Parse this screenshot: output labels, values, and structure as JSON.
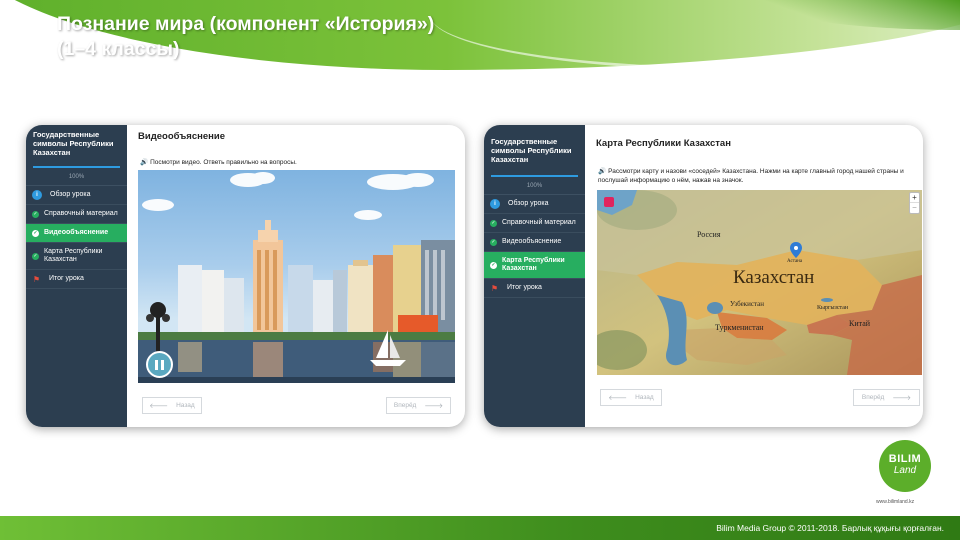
{
  "header": {
    "title_line1": "Познание мира (компонент «История»)",
    "title_line2": "(1–4 классы)"
  },
  "left_card": {
    "sidebar": {
      "title": "Государственные символы Республики Казахстан",
      "progress_percent": "100%",
      "progress_value": 1.0,
      "items": [
        {
          "label": "Обзор урока",
          "icon": "info-icon"
        },
        {
          "label": "Справочный материал",
          "icon": "check-icon"
        },
        {
          "label": "Видеообъяснение",
          "icon": "check-icon",
          "active": true
        },
        {
          "label": "Карта Республики Казахстан",
          "icon": "check-icon"
        },
        {
          "label": "Итог урока",
          "icon": "flag-icon"
        }
      ]
    },
    "content": {
      "title": "Видеообъяснение",
      "instruction": "Посмотри видео. Ответь правильно на вопросы.",
      "back_label": "Назад",
      "next_label": "Вперёд"
    }
  },
  "right_card": {
    "sidebar": {
      "title": "Государственные символы Республики Казахстан",
      "progress_percent": "100%",
      "progress_value": 1.0,
      "items": [
        {
          "label": "Обзор урока",
          "icon": "info-icon"
        },
        {
          "label": "Справочный материал",
          "icon": "check-icon"
        },
        {
          "label": "Видеообъяснение",
          "icon": "check-icon"
        },
        {
          "label": "Карта Республики Казахстан",
          "icon": "check-icon",
          "active": true
        },
        {
          "label": "Итог урока",
          "icon": "flag-icon"
        }
      ]
    },
    "content": {
      "title": "Карта Республики Казахстан",
      "instruction": "Рассмотри карту и назови «соседей» Казахстана. Нажми на карте главный город нашей страны и послушай информацию о нём, нажав на значок.",
      "map_labels": {
        "russia": "Россия",
        "kazakhstan": "Казахстан",
        "astana": "Астана",
        "uzbekistan": "Узбекистан",
        "kyrgyzstan": "Кыргызстан",
        "turkmenistan": "Туркменистан",
        "china": "Китай"
      },
      "zoom_in": "+",
      "zoom_out": "−",
      "back_label": "Назад",
      "next_label": "Вперёд"
    }
  },
  "logo": {
    "line1": "BILIM",
    "line2": "Land",
    "url": "www.bilimland.kz"
  },
  "footer": {
    "copyright": "Bilim Media Group © 2011-2018. Барлық құқығы қорғалған."
  },
  "colors": {
    "sidebar_bg": "#2c3e50",
    "active_item": "#27ae60",
    "brand_green": "#5cae2a",
    "progress_blue": "#2e9be0"
  }
}
